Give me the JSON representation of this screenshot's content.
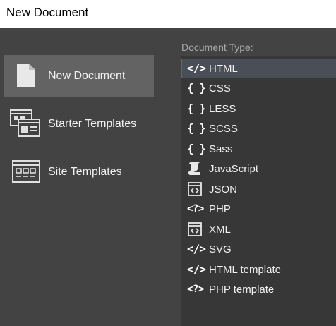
{
  "window": {
    "title": "New Document"
  },
  "sidebar": {
    "items": [
      {
        "label": "New Document",
        "icon": "document-icon",
        "selected": true
      },
      {
        "label": "Starter Templates",
        "icon": "starter-templates-icon",
        "selected": false
      },
      {
        "label": "Site Templates",
        "icon": "site-templates-icon",
        "selected": false
      }
    ]
  },
  "document_type": {
    "label": "Document Type:",
    "selected": "HTML",
    "items": [
      {
        "label": "HTML",
        "icon": "code-tag-icon",
        "glyph": "</>"
      },
      {
        "label": "CSS",
        "icon": "curly-braces-icon",
        "glyph": "{ }"
      },
      {
        "label": "LESS",
        "icon": "curly-braces-icon",
        "glyph": "{ }"
      },
      {
        "label": "SCSS",
        "icon": "curly-braces-icon",
        "glyph": "{ }"
      },
      {
        "label": "Sass",
        "icon": "curly-braces-icon",
        "glyph": "{ }"
      },
      {
        "label": "JavaScript",
        "icon": "javascript-icon",
        "glyph": ""
      },
      {
        "label": "JSON",
        "icon": "json-window-icon",
        "glyph": ""
      },
      {
        "label": "PHP",
        "icon": "php-tag-icon",
        "glyph": "<?>"
      },
      {
        "label": "XML",
        "icon": "xml-window-icon",
        "glyph": ""
      },
      {
        "label": "SVG",
        "icon": "code-tag-icon",
        "glyph": "</>"
      },
      {
        "label": "HTML template",
        "icon": "code-tag-icon",
        "glyph": "</>"
      },
      {
        "label": "PHP template",
        "icon": "php-tag-icon",
        "glyph": "<?>"
      }
    ]
  },
  "colors": {
    "sidebar_bg": "#434343",
    "sidebar_selected": "#636363",
    "list_bg": "#373737",
    "list_selected": "#4a4e57",
    "text": "#f2f2f2",
    "label_muted": "#a8a8a8"
  }
}
